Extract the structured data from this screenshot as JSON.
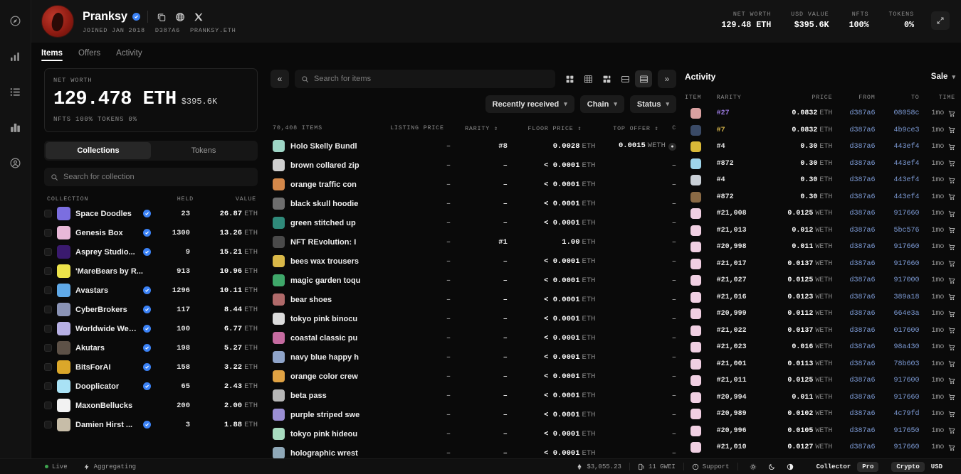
{
  "rail": {
    "items": [
      {
        "name": "explore-icon"
      },
      {
        "name": "analytics-icon"
      },
      {
        "name": "list-icon"
      },
      {
        "name": "leaderboard-icon"
      },
      {
        "name": "profile-icon"
      }
    ]
  },
  "header": {
    "display_name": "Pranksy",
    "verified": true,
    "actions": [
      {
        "name": "copy-icon"
      },
      {
        "name": "globe-icon"
      },
      {
        "name": "x-twitter-icon"
      }
    ],
    "meta": {
      "joined": "JOINED JAN 2018",
      "address": "D387A6",
      "ens": "PRANKSY.ETH"
    },
    "stats": [
      {
        "label": "NET WORTH",
        "value": "129.48 ETH"
      },
      {
        "label": "USD VALUE",
        "value": "$395.6K"
      },
      {
        "label": "NFTS",
        "value": "100%"
      },
      {
        "label": "TOKENS",
        "value": "0%"
      }
    ],
    "expand_label": "expand-icon"
  },
  "tabs": [
    {
      "label": "Items",
      "active": true
    },
    {
      "label": "Offers",
      "active": false
    },
    {
      "label": "Activity",
      "active": false
    }
  ],
  "left": {
    "networth": {
      "label": "NET WORTH",
      "eth": "129.478 ETH",
      "usd": "$395.6K",
      "sub": "NFTS 100%   TOKENS 0%"
    },
    "segments": [
      {
        "label": "Collections",
        "active": true
      },
      {
        "label": "Tokens",
        "active": false
      }
    ],
    "search": {
      "placeholder": "Search for collection",
      "value": ""
    },
    "columns": {
      "collection": "COLLECTION",
      "held": "HELD",
      "value": "VALUE"
    },
    "collections": [
      {
        "name": "Space Doodles",
        "verified": true,
        "held": "23",
        "value": "26.87",
        "unit": "ETH",
        "color": "#7b6ee0"
      },
      {
        "name": "Genesis Box",
        "verified": true,
        "held": "1300",
        "value": "13.26",
        "unit": "ETH",
        "color": "#e9b8d8"
      },
      {
        "name": "Asprey Studio...",
        "verified": true,
        "held": "9",
        "value": "15.21",
        "unit": "ETH",
        "color": "#3a1a6e"
      },
      {
        "name": "'MareBears by R...",
        "verified": false,
        "held": "913",
        "value": "10.96",
        "unit": "ETH",
        "color": "#ece34a"
      },
      {
        "name": "Avastars",
        "verified": true,
        "held": "1296",
        "value": "10.11",
        "unit": "ETH",
        "color": "#5fa9e8"
      },
      {
        "name": "CyberBrokers",
        "verified": true,
        "held": "117",
        "value": "8.44",
        "unit": "ETH",
        "color": "#8a93b5"
      },
      {
        "name": "Worldwide Web...",
        "verified": true,
        "held": "100",
        "value": "6.77",
        "unit": "ETH",
        "color": "#b7b0e4"
      },
      {
        "name": "Akutars",
        "verified": true,
        "held": "198",
        "value": "5.27",
        "unit": "ETH",
        "color": "#5d5147"
      },
      {
        "name": "BitsForAI",
        "verified": true,
        "held": "158",
        "value": "3.22",
        "unit": "ETH",
        "color": "#dba72a"
      },
      {
        "name": "Dooplicator",
        "verified": true,
        "held": "65",
        "value": "2.43",
        "unit": "ETH",
        "color": "#a9e2f5"
      },
      {
        "name": "MaxonBellucks",
        "verified": false,
        "held": "200",
        "value": "2.00",
        "unit": "ETH",
        "color": "#f2f2f2"
      },
      {
        "name": "Damien Hirst ...",
        "verified": true,
        "held": "3",
        "value": "1.88",
        "unit": "ETH",
        "color": "#c7bda8"
      }
    ]
  },
  "center": {
    "collapse_left_label": "collapse-left-icon",
    "collapse_right_label": "expand-right-icon",
    "search": {
      "placeholder": "Search for items",
      "value": ""
    },
    "view_modes": [
      {
        "name": "grid-large-icon",
        "active": false
      },
      {
        "name": "grid-dense-icon",
        "active": false
      },
      {
        "name": "grid-mixed-icon",
        "active": false
      },
      {
        "name": "list-compact-icon",
        "active": false
      },
      {
        "name": "list-rows-icon",
        "active": true
      }
    ],
    "filters": [
      {
        "label": "Recently received"
      },
      {
        "label": "Chain"
      },
      {
        "label": "Status"
      }
    ],
    "columns": {
      "items": "70,408 ITEMS",
      "listing_price": "LISTING PRICE",
      "rarity": "RARITY",
      "floor_price": "FLOOR PRICE",
      "top_offer": "TOP OFFER",
      "cut": "C"
    },
    "rows": [
      {
        "name": "Holo Skelly Bundl",
        "listing": "–",
        "rarity": "#8",
        "floor": "0.0028",
        "floor_unit": "ETH",
        "top": "0.0015",
        "top_unit": "WETH",
        "top_badge": true,
        "color": "#9ed6c6"
      },
      {
        "name": "brown collared zip",
        "listing": "–",
        "rarity": "–",
        "floor": "< 0.0001",
        "floor_unit": "ETH",
        "top": "–",
        "top_unit": "",
        "top_badge": false,
        "color": "#cfcfcf"
      },
      {
        "name": "orange traffic con",
        "listing": "–",
        "rarity": "–",
        "floor": "< 0.0001",
        "floor_unit": "ETH",
        "top": "–",
        "top_unit": "",
        "top_badge": false,
        "color": "#d4884a"
      },
      {
        "name": "black skull hoodie",
        "listing": "–",
        "rarity": "–",
        "floor": "< 0.0001",
        "floor_unit": "ETH",
        "top": "–",
        "top_unit": "",
        "top_badge": false,
        "color": "#6e6e6e"
      },
      {
        "name": "green stitched up",
        "listing": "–",
        "rarity": "–",
        "floor": "< 0.0001",
        "floor_unit": "ETH",
        "top": "–",
        "top_unit": "",
        "top_badge": false,
        "color": "#2f8a7a"
      },
      {
        "name": "NFT REvolution: I",
        "listing": "–",
        "rarity": "#1",
        "floor": "1.00",
        "floor_unit": "ETH",
        "top": "–",
        "top_unit": "",
        "top_badge": false,
        "color": "#4a4a4a"
      },
      {
        "name": "bees wax trousers",
        "listing": "–",
        "rarity": "–",
        "floor": "< 0.0001",
        "floor_unit": "ETH",
        "top": "–",
        "top_unit": "",
        "top_badge": false,
        "color": "#d9b848"
      },
      {
        "name": "magic garden toqu",
        "listing": "–",
        "rarity": "–",
        "floor": "< 0.0001",
        "floor_unit": "ETH",
        "top": "–",
        "top_unit": "",
        "top_badge": false,
        "color": "#3fa86a"
      },
      {
        "name": "bear shoes",
        "listing": "–",
        "rarity": "–",
        "floor": "< 0.0001",
        "floor_unit": "ETH",
        "top": "–",
        "top_unit": "",
        "top_badge": false,
        "color": "#b06a6a"
      },
      {
        "name": "tokyo pink binocu",
        "listing": "–",
        "rarity": "–",
        "floor": "< 0.0001",
        "floor_unit": "ETH",
        "top": "–",
        "top_unit": "",
        "top_badge": false,
        "color": "#dcdcdc"
      },
      {
        "name": "coastal classic pu",
        "listing": "–",
        "rarity": "–",
        "floor": "< 0.0001",
        "floor_unit": "ETH",
        "top": "–",
        "top_unit": "",
        "top_badge": false,
        "color": "#c56ba0"
      },
      {
        "name": "navy blue happy h",
        "listing": "–",
        "rarity": "–",
        "floor": "< 0.0001",
        "floor_unit": "ETH",
        "top": "–",
        "top_unit": "",
        "top_badge": false,
        "color": "#8fa4c9"
      },
      {
        "name": "orange color crew",
        "listing": "–",
        "rarity": "–",
        "floor": "< 0.0001",
        "floor_unit": "ETH",
        "top": "–",
        "top_unit": "",
        "top_badge": false,
        "color": "#e0a243"
      },
      {
        "name": "beta pass",
        "listing": "–",
        "rarity": "–",
        "floor": "< 0.0001",
        "floor_unit": "ETH",
        "top": "–",
        "top_unit": "",
        "top_badge": false,
        "color": "#b7b7b7"
      },
      {
        "name": "purple striped swe",
        "listing": "–",
        "rarity": "–",
        "floor": "< 0.0001",
        "floor_unit": "ETH",
        "top": "–",
        "top_unit": "",
        "top_badge": false,
        "color": "#9b8fd4"
      },
      {
        "name": "tokyo pink hideou",
        "listing": "–",
        "rarity": "–",
        "floor": "< 0.0001",
        "floor_unit": "ETH",
        "top": "–",
        "top_unit": "",
        "top_badge": false,
        "color": "#a8dcc0"
      },
      {
        "name": "holographic wrest",
        "listing": "–",
        "rarity": "–",
        "floor": "< 0.0001",
        "floor_unit": "ETH",
        "top": "–",
        "top_unit": "",
        "top_badge": false,
        "color": "#8fa8b8"
      }
    ]
  },
  "right": {
    "title": "Activity",
    "filter": "Sale",
    "columns": {
      "item": "ITEM",
      "rarity": "RARITY",
      "price": "PRICE",
      "from": "FROM",
      "to": "TO",
      "time": "TIME"
    },
    "rows": [
      {
        "rarity": "#27",
        "rarity_color": "#9b7ae0",
        "price": "0.0832",
        "unit": "ETH",
        "from": "d387a6",
        "to": "08058c",
        "time": "1mo",
        "color": "#d9a0a0"
      },
      {
        "rarity": "#7",
        "rarity_color": "#d4b44a",
        "price": "0.0832",
        "unit": "ETH",
        "from": "d387a6",
        "to": "4b9ce3",
        "time": "1mo",
        "color": "#3a4a66"
      },
      {
        "rarity": "#4",
        "rarity_color": "#e6e6e6",
        "price": "0.30",
        "unit": "ETH",
        "from": "d387a6",
        "to": "443ef4",
        "time": "1mo",
        "color": "#d8b838"
      },
      {
        "rarity": "#872",
        "rarity_color": "#e6e6e6",
        "price": "0.30",
        "unit": "ETH",
        "from": "d387a6",
        "to": "443ef4",
        "time": "1mo",
        "color": "#9fd4ea"
      },
      {
        "rarity": "#4",
        "rarity_color": "#e6e6e6",
        "price": "0.30",
        "unit": "ETH",
        "from": "d387a6",
        "to": "443ef4",
        "time": "1mo",
        "color": "#c9cfd6"
      },
      {
        "rarity": "#872",
        "rarity_color": "#e6e6e6",
        "price": "0.30",
        "unit": "ETH",
        "from": "d387a6",
        "to": "443ef4",
        "time": "1mo",
        "color": "#8a6a45"
      },
      {
        "rarity": "#21,008",
        "rarity_color": "#e6e6e6",
        "price": "0.0125",
        "unit": "WETH",
        "from": "d387a6",
        "to": "917660",
        "time": "1mo",
        "color": "#f0cfe2"
      },
      {
        "rarity": "#21,013",
        "rarity_color": "#e6e6e6",
        "price": "0.012",
        "unit": "WETH",
        "from": "d387a6",
        "to": "5bc576",
        "time": "1mo",
        "color": "#f0cfe2"
      },
      {
        "rarity": "#20,998",
        "rarity_color": "#e6e6e6",
        "price": "0.011",
        "unit": "WETH",
        "from": "d387a6",
        "to": "917660",
        "time": "1mo",
        "color": "#f0cfe2"
      },
      {
        "rarity": "#21,017",
        "rarity_color": "#e6e6e6",
        "price": "0.0137",
        "unit": "WETH",
        "from": "d387a6",
        "to": "917660",
        "time": "1mo",
        "color": "#f0cfe2"
      },
      {
        "rarity": "#21,027",
        "rarity_color": "#e6e6e6",
        "price": "0.0125",
        "unit": "WETH",
        "from": "d387a6",
        "to": "917000",
        "time": "1mo",
        "color": "#f0cfe2"
      },
      {
        "rarity": "#21,016",
        "rarity_color": "#e6e6e6",
        "price": "0.0123",
        "unit": "WETH",
        "from": "d387a6",
        "to": "389a18",
        "time": "1mo",
        "color": "#f0cfe2"
      },
      {
        "rarity": "#20,999",
        "rarity_color": "#e6e6e6",
        "price": "0.0112",
        "unit": "WETH",
        "from": "d387a6",
        "to": "664e3a",
        "time": "1mo",
        "color": "#f0cfe2"
      },
      {
        "rarity": "#21,022",
        "rarity_color": "#e6e6e6",
        "price": "0.0137",
        "unit": "WETH",
        "from": "d387a6",
        "to": "017600",
        "time": "1mo",
        "color": "#f0cfe2"
      },
      {
        "rarity": "#21,023",
        "rarity_color": "#e6e6e6",
        "price": "0.016",
        "unit": "WETH",
        "from": "d387a6",
        "to": "98a430",
        "time": "1mo",
        "color": "#f0cfe2"
      },
      {
        "rarity": "#21,001",
        "rarity_color": "#e6e6e6",
        "price": "0.0113",
        "unit": "WETH",
        "from": "d387a6",
        "to": "78b603",
        "time": "1mo",
        "color": "#f0cfe2"
      },
      {
        "rarity": "#21,011",
        "rarity_color": "#e6e6e6",
        "price": "0.0125",
        "unit": "WETH",
        "from": "d387a6",
        "to": "917600",
        "time": "1mo",
        "color": "#f0cfe2"
      },
      {
        "rarity": "#20,994",
        "rarity_color": "#e6e6e6",
        "price": "0.011",
        "unit": "WETH",
        "from": "d387a6",
        "to": "917660",
        "time": "1mo",
        "color": "#f0cfe2"
      },
      {
        "rarity": "#20,989",
        "rarity_color": "#e6e6e6",
        "price": "0.0102",
        "unit": "WETH",
        "from": "d387a6",
        "to": "4c79fd",
        "time": "1mo",
        "color": "#f0cfe2"
      },
      {
        "rarity": "#20,996",
        "rarity_color": "#e6e6e6",
        "price": "0.0105",
        "unit": "WETH",
        "from": "d387a6",
        "to": "917650",
        "time": "1mo",
        "color": "#f0cfe2"
      },
      {
        "rarity": "#21,010",
        "rarity_color": "#e6e6e6",
        "price": "0.0127",
        "unit": "WETH",
        "from": "d387a6",
        "to": "917660",
        "time": "1mo",
        "color": "#f0cfe2"
      }
    ]
  },
  "footer": {
    "live": "Live",
    "aggregating": "Aggregating",
    "eth_price": "$3,055.23",
    "gas": "11 GWEI",
    "support": "Support",
    "theme_icons": [
      "sun-icon",
      "moon-icon",
      "contrast-icon"
    ],
    "mode_left": "Collector",
    "mode_right": "Pro",
    "currency_left": "Crypto",
    "currency_right": "USD"
  },
  "colors": {
    "accent_blue": "#3b82f6",
    "link_blue": "#7d9bd6",
    "live_green": "#3ea44f",
    "background": "#0a0a0a"
  }
}
